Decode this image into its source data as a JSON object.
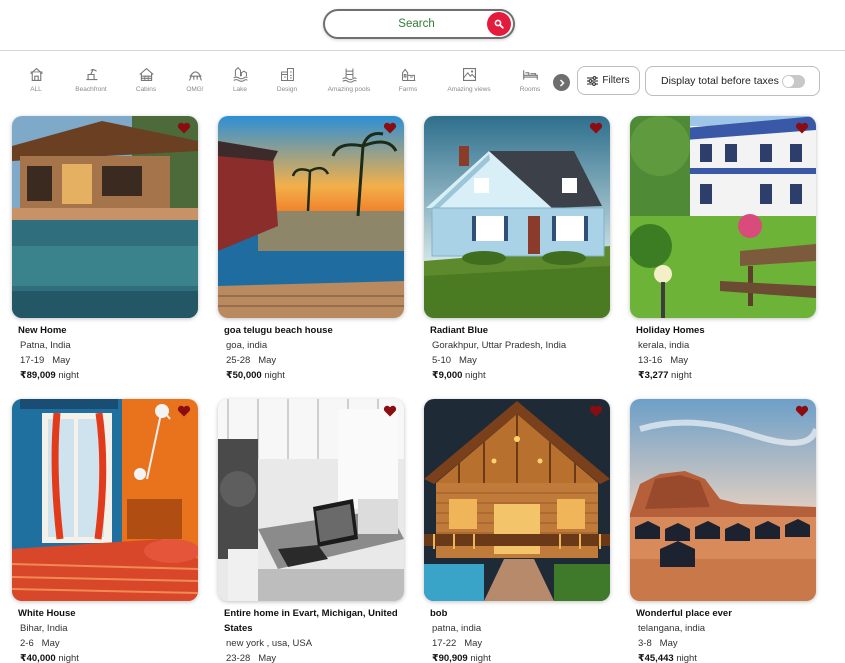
{
  "search": {
    "label": "Search"
  },
  "categories": [
    {
      "label": "ALL",
      "icon": "house-icon"
    },
    {
      "label": "Beachfront",
      "icon": "beach-icon"
    },
    {
      "label": "Cabins",
      "icon": "cabin-icon"
    },
    {
      "label": "OMG!",
      "icon": "ufo-house-icon"
    },
    {
      "label": "Lake",
      "icon": "lake-icon"
    },
    {
      "label": "Design",
      "icon": "design-icon"
    },
    {
      "label": "Amazing pools",
      "icon": "pool-icon"
    },
    {
      "label": "Farms",
      "icon": "farm-icon"
    },
    {
      "label": "Amazing views",
      "icon": "view-icon"
    },
    {
      "label": "Rooms",
      "icon": "bed-icon"
    }
  ],
  "filters": {
    "label": "Filters"
  },
  "taxes": {
    "label": "Display total before taxes"
  },
  "colors": {
    "accent": "#e31c3d",
    "search_text": "#2e7d32",
    "heart": "#8b0d12"
  },
  "listings": [
    {
      "title": "New Home",
      "location": "Patna, India",
      "dates": "17-19",
      "month": "May",
      "price": "₹89,009",
      "unit": "night"
    },
    {
      "title": "goa telugu beach house",
      "location": "goa, india",
      "dates": "25-28",
      "month": "May",
      "price": "₹50,000",
      "unit": "night"
    },
    {
      "title": "Radiant Blue",
      "location": "Gorakhpur, Uttar Pradesh, India",
      "dates": "5-10",
      "month": "May",
      "price": "₹9,000",
      "unit": "night"
    },
    {
      "title": "Holiday Homes",
      "location": "kerala, india",
      "dates": "13-16",
      "month": "May",
      "price": "₹3,277",
      "unit": "night"
    },
    {
      "title": "White House",
      "location": "Bihar, India",
      "dates": "2-6",
      "month": "May",
      "price": "₹40,000",
      "unit": "night"
    },
    {
      "title": "Entire home in Evart, Michigan, United States",
      "location": "new york , usa, USA",
      "dates": "23-28",
      "month": "May",
      "price": "",
      "unit": ""
    },
    {
      "title": "bob",
      "location": "patna, india",
      "dates": "17-22",
      "month": "May",
      "price": "₹90,909",
      "unit": "night"
    },
    {
      "title": "Wonderful place ever",
      "location": "telangana, india",
      "dates": "3-8",
      "month": "May",
      "price": "₹45,443",
      "unit": "night"
    }
  ]
}
